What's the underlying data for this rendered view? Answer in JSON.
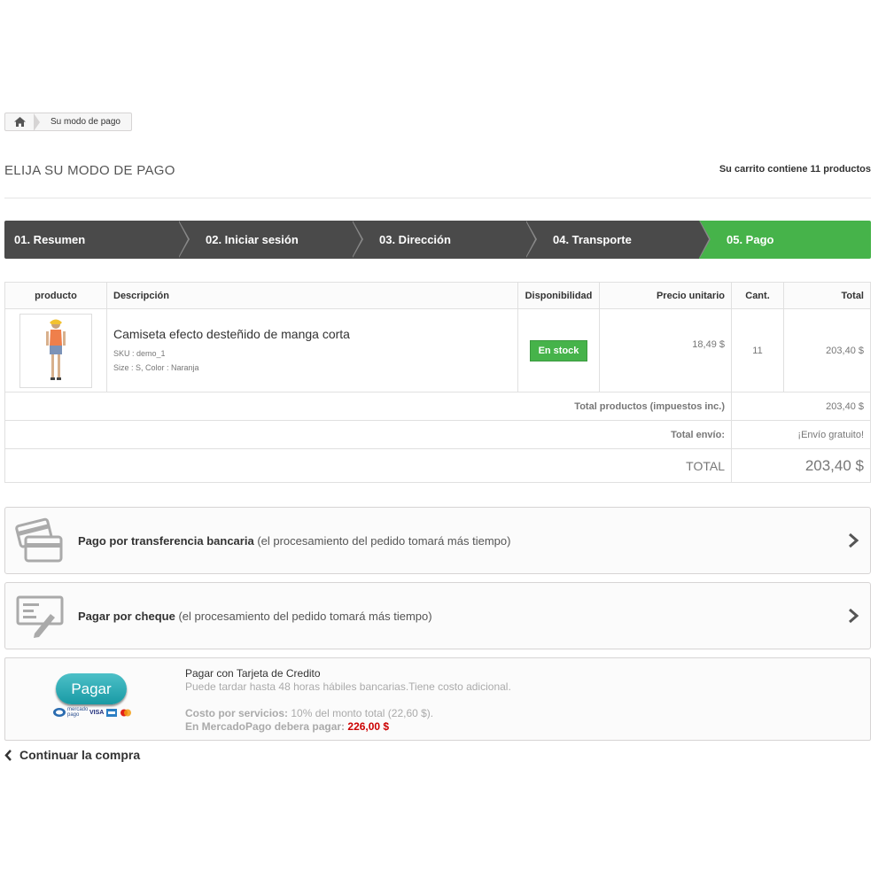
{
  "breadcrumb": {
    "current": "Su modo de pago"
  },
  "page": {
    "heading": "ELIJA SU MODO DE PAGO",
    "cart_summary": "Su carrito contiene 11 productos"
  },
  "steps": [
    {
      "label": "01. Resumen"
    },
    {
      "label": "02. Iniciar sesión"
    },
    {
      "label": "03. Dirección"
    },
    {
      "label": "04. Transporte"
    },
    {
      "label": "05. Pago",
      "active": true
    }
  ],
  "table": {
    "headers": [
      "producto",
      "Descripción",
      "Disponibilidad",
      "Precio unitario",
      "Cant.",
      "Total"
    ],
    "row": {
      "name": "Camiseta efecto desteñido de manga corta",
      "sku": "SKU : demo_1",
      "attributes": "Size : S, Color : Naranja",
      "availability": "En stock",
      "unit_price": "18,49 $",
      "qty": "11",
      "total": "203,40 $"
    },
    "totals": [
      {
        "label": "Total productos (impuestos inc.)",
        "value": "203,40 $"
      },
      {
        "label": "Total envío:",
        "value": "¡Envío gratuito!"
      }
    ],
    "grand_total": {
      "label": "TOTAL",
      "value": "203,40 $"
    }
  },
  "payments": {
    "bank": {
      "title": "Pago por transferencia bancaria",
      "note": "(el procesamiento del pedido tomará más tiempo)"
    },
    "cheque": {
      "title": "Pagar por cheque",
      "note": "(el procesamiento del pedido tomará más tiempo)"
    },
    "mercadopago": {
      "button": "Pagar",
      "cards_label": "mercado pago",
      "visa": "VISA",
      "title": "Pagar con Tarjeta de Credito",
      "subtitle": "Puede tardar hasta 48 horas hábiles bancarias.Tiene costo adicional.",
      "fee_label": "Costo por servicios:",
      "fee_value": "10% del monto total (22,60 $).",
      "pay_label": "En MercadoPago debera pagar:",
      "pay_value": "226,00 $"
    }
  },
  "continue": {
    "label": "Continuar la compra"
  },
  "colors": {
    "step_dark": "#4a4a4a",
    "step_active": "#46b34a",
    "stock_badge": "#46b34a",
    "price_red": "#cc0000"
  }
}
